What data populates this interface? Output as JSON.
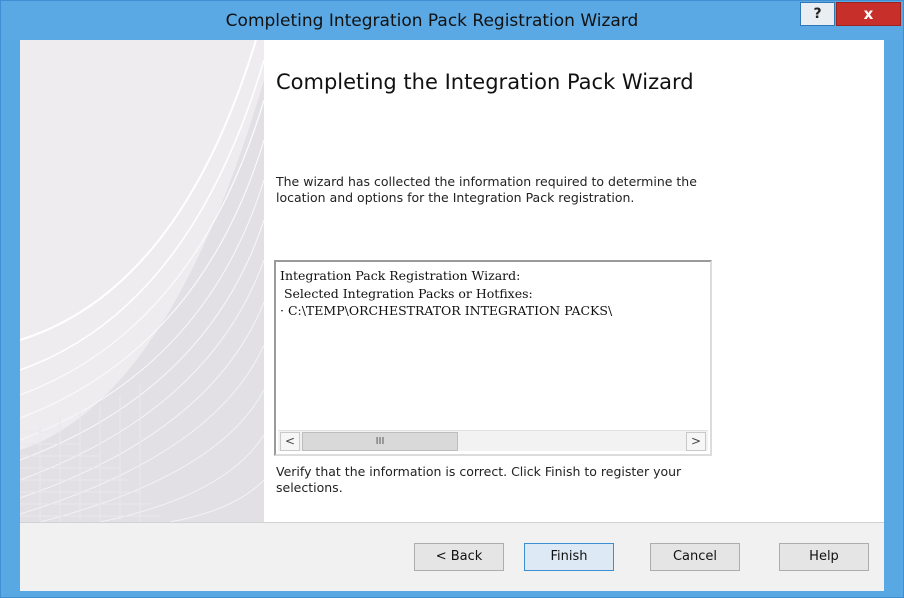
{
  "window": {
    "title": "Completing Integration Pack Registration Wizard",
    "help_label": "?",
    "close_label": "x"
  },
  "content": {
    "heading": "Completing the Integration Pack Wizard",
    "description": "The wizard has collected the information required to determine the location and options for the Integration Pack registration.",
    "summary_lines": [
      "Integration Pack Registration Wizard:",
      " Selected Integration Packs or Hotfixes:",
      "· C:\\TEMP\\ORCHESTRATOR INTEGRATION PACKS\\"
    ],
    "verify_text": "Verify that the information is correct.  Click Finish to register your selections."
  },
  "scrollbar": {
    "left_arrow": "<",
    "right_arrow": ">",
    "thumb_grip": "III"
  },
  "buttons": {
    "back": "< Back",
    "finish": "Finish",
    "cancel": "Cancel",
    "help": "Help"
  },
  "colors": {
    "titlebar": "#5aa9e4",
    "close": "#c7302a",
    "side_panel": "#eeecef"
  }
}
